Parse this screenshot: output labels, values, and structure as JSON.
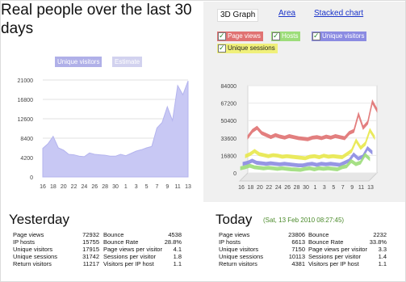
{
  "title": "Real people over the last 30 days",
  "left_legend": {
    "unique_visitors": "Unique visitors",
    "estimate": "Estimate"
  },
  "tabs": [
    "3D Graph",
    "Area",
    "Stacked chart"
  ],
  "series_checkboxes": [
    "Page views",
    "Hosts",
    "Unique visitors",
    "Unique sessions"
  ],
  "colors": {
    "area_fill": "#c8c8f4",
    "page_views": "#e07272",
    "hosts": "#9ddd7a",
    "unique_visitors": "#8b8be2",
    "unique_sessions": "#e8e84c",
    "tab_link": "#1a33c9",
    "date_text": "#4a8a2a"
  },
  "chart_data": [
    {
      "type": "area",
      "title": "",
      "categories": [
        "16",
        "17",
        "18",
        "19",
        "20",
        "21",
        "22",
        "23",
        "24",
        "25",
        "26",
        "27",
        "28",
        "29",
        "30",
        "31",
        "1",
        "2",
        "3",
        "4",
        "5",
        "6",
        "7",
        "8",
        "9",
        "10",
        "11",
        "12",
        "13"
      ],
      "x_tick_labels": [
        "16",
        "18",
        "20",
        "22",
        "24",
        "26",
        "28",
        "30",
        "1",
        "3",
        "5",
        "7",
        "9",
        "11",
        "13"
      ],
      "series": [
        {
          "name": "Unique visitors",
          "values": [
            6200,
            7200,
            8800,
            6300,
            5800,
            4900,
            4800,
            4500,
            4400,
            5200,
            4900,
            4800,
            4700,
            4500,
            4500,
            4900,
            4600,
            5100,
            5600,
            5900,
            6300,
            6600,
            10600,
            11800,
            15200,
            12200,
            19800,
            17800,
            20800
          ]
        }
      ],
      "ylim": [
        0,
        21000
      ],
      "y_ticks": [
        "21000",
        "16800",
        "12600",
        "8400",
        "4200",
        "0"
      ],
      "grid": true
    },
    {
      "type": "line",
      "title": "3D Graph",
      "categories": [
        "16",
        "17",
        "18",
        "19",
        "20",
        "21",
        "22",
        "23",
        "24",
        "25",
        "26",
        "27",
        "28",
        "29",
        "30",
        "31",
        "1",
        "2",
        "3",
        "4",
        "5",
        "6",
        "7",
        "8",
        "9",
        "10",
        "11",
        "12",
        "13"
      ],
      "x_tick_labels": [
        "16",
        "18",
        "20",
        "22",
        "24",
        "26",
        "28",
        "30",
        "1",
        "3",
        "5",
        "7",
        "9",
        "11",
        "13"
      ],
      "series": [
        {
          "name": "Page views",
          "values": [
            36000,
            42000,
            45000,
            40000,
            38000,
            36000,
            38000,
            36500,
            35500,
            37000,
            36000,
            35000,
            34500,
            34000,
            35500,
            36000,
            35000,
            36500,
            35500,
            37000,
            36000,
            35000,
            40000,
            42000,
            58000,
            45000,
            50000,
            70000,
            62000
          ]
        },
        {
          "name": "Unique sessions",
          "values": [
            20000,
            22000,
            25000,
            22000,
            21000,
            20000,
            21000,
            20500,
            19500,
            20000,
            19500,
            19000,
            18500,
            18000,
            19500,
            20000,
            19000,
            20500,
            19500,
            20000,
            19500,
            19000,
            22000,
            25000,
            35000,
            28000,
            32000,
            45000,
            38000
          ]
        },
        {
          "name": "Unique visitors",
          "values": [
            15000,
            16000,
            18000,
            16000,
            15500,
            15000,
            15500,
            15000,
            14500,
            15000,
            14500,
            14000,
            13500,
            13500,
            14500,
            15000,
            14000,
            15000,
            14500,
            15000,
            14500,
            14000,
            16000,
            18000,
            24000,
            20000,
            22000,
            30000,
            26000
          ]
        },
        {
          "name": "Hosts",
          "values": [
            13000,
            14000,
            15500,
            14000,
            13500,
            13000,
            13500,
            13000,
            12500,
            13000,
            12500,
            12000,
            11800,
            11500,
            12500,
            13000,
            12000,
            13000,
            12500,
            13000,
            12500,
            12000,
            14000,
            15000,
            20000,
            17000,
            18500,
            26000,
            22000
          ]
        }
      ],
      "ylim": [
        0,
        84000
      ],
      "y_ticks": [
        "84000",
        "67200",
        "50400",
        "33600",
        "16800",
        "0"
      ],
      "grid": true
    }
  ],
  "yesterday": {
    "heading": "Yesterday",
    "left": [
      {
        "label": "Page views",
        "value": "72932"
      },
      {
        "label": "IP hosts",
        "value": "15755"
      },
      {
        "label": "Unique visitors",
        "value": "17915"
      },
      {
        "label": "Unique sessions",
        "value": "31742"
      },
      {
        "label": "Return visitors",
        "value": "11217"
      }
    ],
    "right": [
      {
        "label": "Bounce",
        "value": "4538"
      },
      {
        "label": "Bounce Rate",
        "value": "28.8%"
      },
      {
        "label": "Page views per visitor",
        "value": "4.1"
      },
      {
        "label": "Sessions per visitor",
        "value": "1.8"
      },
      {
        "label": "Visitors per IP host",
        "value": "1.1"
      }
    ]
  },
  "today": {
    "heading": "Today",
    "date": "(Sat, 13 Feb 2010 08:27:45)",
    "left": [
      {
        "label": "Page views",
        "value": "23806"
      },
      {
        "label": "IP hosts",
        "value": "6613"
      },
      {
        "label": "Unique visitors",
        "value": "7150"
      },
      {
        "label": "Unique sessions",
        "value": "10113"
      },
      {
        "label": "Return visitors",
        "value": "4381"
      }
    ],
    "right": [
      {
        "label": "Bounce",
        "value": "2232"
      },
      {
        "label": "Bounce Rate",
        "value": "33.8%"
      },
      {
        "label": "Page views per visitor",
        "value": "3.3"
      },
      {
        "label": "Sessions per visitor",
        "value": "1.4"
      },
      {
        "label": "Visitors per IP host",
        "value": "1.1"
      }
    ]
  }
}
